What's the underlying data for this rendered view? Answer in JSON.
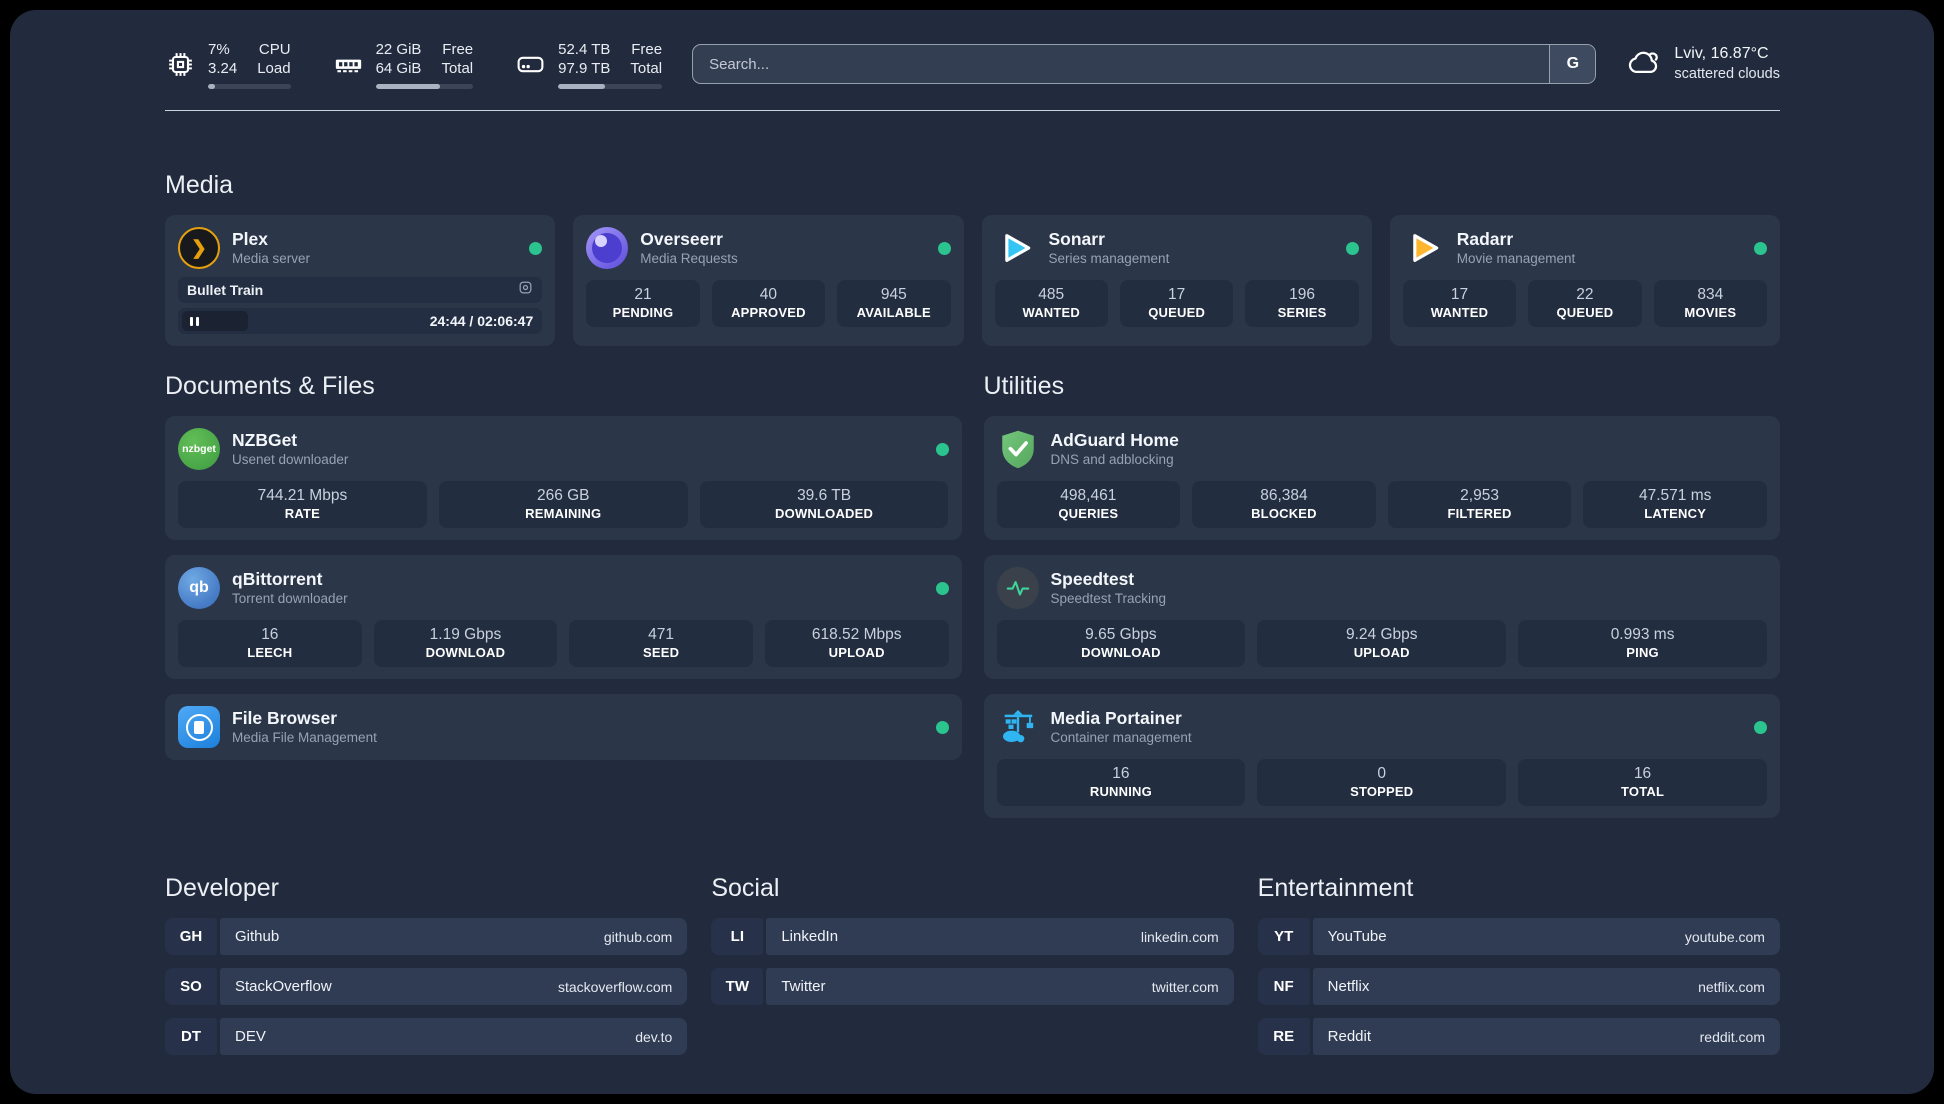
{
  "colors": {
    "status_online_green": "#2BC48F",
    "plex_amber": "#E5A00D",
    "sonarr_blue": "#35C5F4",
    "radarr_yellow": "#FFB52E",
    "nzbget_green": "#4CAF50",
    "adguard_green": "#67B279",
    "qbittorrent_blue": "#3568B8",
    "speedtest_pulse_green": "#3ED598",
    "filebrowser_blue": "#2196F3",
    "portainer_blue": "#2FB6F2",
    "page_background": "#222B3D",
    "card_background": "#2B3649"
  },
  "header": {
    "metrics": [
      {
        "icon": "cpu-icon",
        "line1": "7%",
        "line2": "3.24",
        "label1": "CPU",
        "label2": "Load",
        "progress_pct": 8
      },
      {
        "icon": "ram-icon",
        "line1": "22 GiB",
        "line2": "64 GiB",
        "label1": "Free",
        "label2": "Total",
        "progress_pct": 66
      },
      {
        "icon": "disk-icon",
        "line1": "52.4 TB",
        "line2": "97.9 TB",
        "label1": "Free",
        "label2": "Total",
        "progress_pct": 45
      }
    ],
    "search": {
      "placeholder": "Search...",
      "engine_button": "G"
    },
    "weather": {
      "icon": "cloud-icon",
      "location_temp": "Lviv, 16.87°C",
      "condition": "scattered clouds"
    }
  },
  "sections": {
    "media": {
      "title": "Media",
      "plex": {
        "icon": "plex-icon",
        "name": "Plex",
        "desc": "Media server",
        "online": true,
        "now_playing": "Bullet Train",
        "progress_time": "24:44 / 02:06:47"
      },
      "overseerr": {
        "icon": "overseerr-icon",
        "name": "Overseerr",
        "desc": "Media Requests",
        "online": true,
        "stats": [
          {
            "value": "21",
            "label": "PENDING"
          },
          {
            "value": "40",
            "label": "APPROVED"
          },
          {
            "value": "945",
            "label": "AVAILABLE"
          }
        ]
      },
      "sonarr": {
        "icon": "sonarr-icon",
        "name": "Sonarr",
        "desc": "Series management",
        "online": true,
        "stats": [
          {
            "value": "485",
            "label": "WANTED"
          },
          {
            "value": "17",
            "label": "QUEUED"
          },
          {
            "value": "196",
            "label": "SERIES"
          }
        ]
      },
      "radarr": {
        "icon": "radarr-icon",
        "name": "Radarr",
        "desc": "Movie management",
        "online": true,
        "stats": [
          {
            "value": "17",
            "label": "WANTED"
          },
          {
            "value": "22",
            "label": "QUEUED"
          },
          {
            "value": "834",
            "label": "MOVIES"
          }
        ]
      }
    },
    "documents": {
      "title": "Documents & Files",
      "nzbget": {
        "icon": "nzbget-icon",
        "icon_text": "nzbget",
        "name": "NZBGet",
        "desc": "Usenet downloader",
        "online": true,
        "stats": [
          {
            "value": "744.21 Mbps",
            "label": "RATE"
          },
          {
            "value": "266 GB",
            "label": "REMAINING"
          },
          {
            "value": "39.6 TB",
            "label": "DOWNLOADED"
          }
        ]
      },
      "qbittorrent": {
        "icon": "qbittorrent-icon",
        "icon_text": "qb",
        "name": "qBittorrent",
        "desc": "Torrent downloader",
        "online": true,
        "stats": [
          {
            "value": "16",
            "label": "LEECH"
          },
          {
            "value": "1.19 Gbps",
            "label": "DOWNLOAD"
          },
          {
            "value": "471",
            "label": "SEED"
          },
          {
            "value": "618.52 Mbps",
            "label": "UPLOAD"
          }
        ]
      },
      "filebrowser": {
        "icon": "filebrowser-icon",
        "name": "File Browser",
        "desc": "Media File Management",
        "online": true
      }
    },
    "utilities": {
      "title": "Utilities",
      "adguard": {
        "icon": "adguard-icon",
        "name": "AdGuard Home",
        "desc": "DNS and adblocking",
        "online": false,
        "stats": [
          {
            "value": "498,461",
            "label": "QUERIES"
          },
          {
            "value": "86,384",
            "label": "BLOCKED"
          },
          {
            "value": "2,953",
            "label": "FILTERED"
          },
          {
            "value": "47.571 ms",
            "label": "LATENCY"
          }
        ]
      },
      "speedtest": {
        "icon": "speedtest-icon",
        "name": "Speedtest",
        "desc": "Speedtest Tracking",
        "online": false,
        "stats": [
          {
            "value": "9.65 Gbps",
            "label": "DOWNLOAD"
          },
          {
            "value": "9.24 Gbps",
            "label": "UPLOAD"
          },
          {
            "value": "0.993 ms",
            "label": "PING"
          }
        ]
      },
      "portainer": {
        "icon": "portainer-icon",
        "name": "Media Portainer",
        "desc": "Container management",
        "online": true,
        "stats": [
          {
            "value": "16",
            "label": "RUNNING"
          },
          {
            "value": "0",
            "label": "STOPPED"
          },
          {
            "value": "16",
            "label": "TOTAL"
          }
        ]
      }
    },
    "links": {
      "developer": {
        "title": "Developer",
        "items": [
          {
            "abbr": "GH",
            "name": "Github",
            "url": "github.com"
          },
          {
            "abbr": "SO",
            "name": "StackOverflow",
            "url": "stackoverflow.com"
          },
          {
            "abbr": "DT",
            "name": "DEV",
            "url": "dev.to"
          }
        ]
      },
      "social": {
        "title": "Social",
        "items": [
          {
            "abbr": "LI",
            "name": "LinkedIn",
            "url": "linkedin.com"
          },
          {
            "abbr": "TW",
            "name": "Twitter",
            "url": "twitter.com"
          }
        ]
      },
      "entertainment": {
        "title": "Entertainment",
        "items": [
          {
            "abbr": "YT",
            "name": "YouTube",
            "url": "youtube.com"
          },
          {
            "abbr": "NF",
            "name": "Netflix",
            "url": "netflix.com"
          },
          {
            "abbr": "RE",
            "name": "Reddit",
            "url": "reddit.com"
          }
        ]
      }
    }
  }
}
